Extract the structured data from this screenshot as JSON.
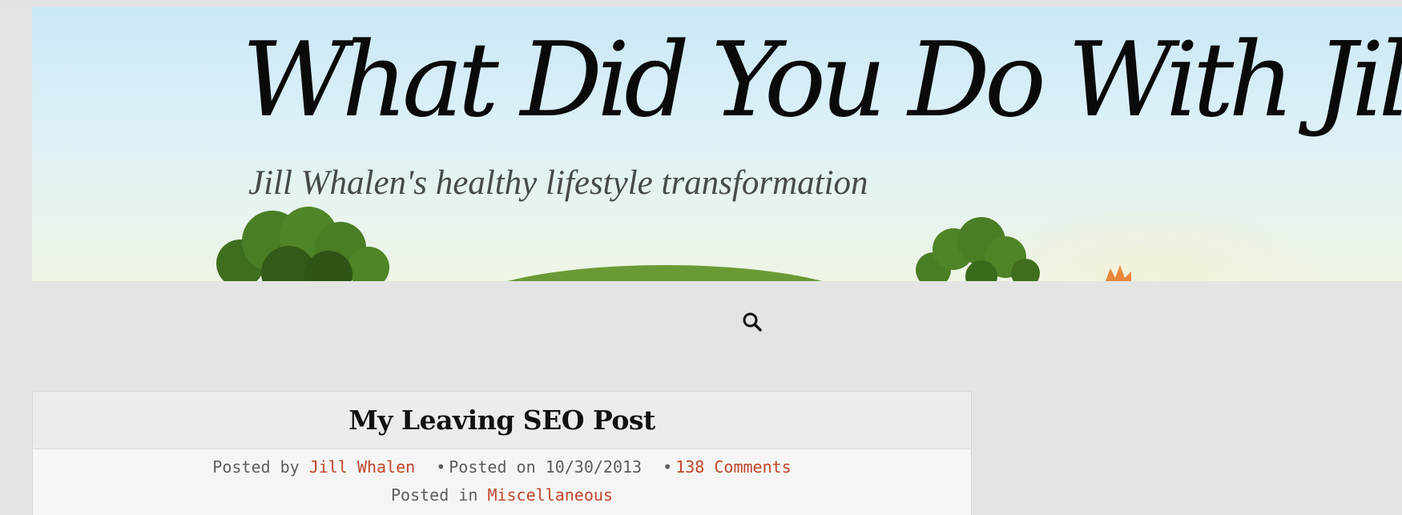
{
  "header": {
    "site_title": "What Did You Do With Jill?",
    "tagline": "Jill Whalen's healthy lifestyle transformation"
  },
  "nav": {
    "search_icon": "search-icon"
  },
  "post": {
    "title": "My Leaving SEO Post",
    "posted_by_label": "Posted by",
    "author": "Jill Whalen",
    "posted_on_label": "Posted on",
    "date": "10/30/2013",
    "comments": "138 Comments",
    "posted_in_label": "Posted in",
    "category": "Miscellaneous",
    "separator": "•"
  },
  "colors": {
    "background": "#e4e4e4",
    "link": "#c0452a",
    "sky": "#c9e7f4",
    "grass": "#6a9a35"
  }
}
